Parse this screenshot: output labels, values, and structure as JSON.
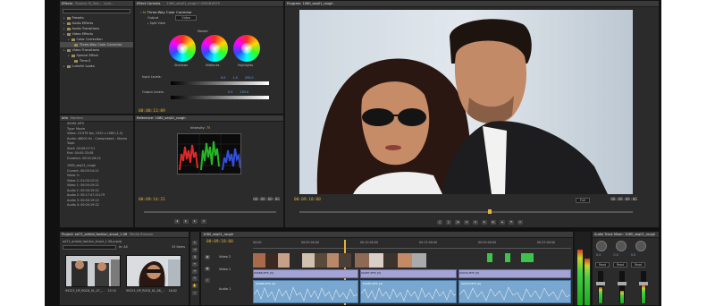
{
  "effects": {
    "tabs": [
      "Effects",
      "Source: FJ_Tod...",
      "Lum..."
    ],
    "search_placeholder": "",
    "tree": [
      {
        "label": "Presets",
        "level": 1
      },
      {
        "label": "Audio Effects",
        "level": 1
      },
      {
        "label": "Audio Transitions",
        "level": 1
      },
      {
        "label": "Video Effects",
        "level": 1
      },
      {
        "label": "Color Correction",
        "level": 2
      },
      {
        "label": "Three-Way Color Corrector",
        "level": 3,
        "selected": true
      },
      {
        "label": "Video Transitions",
        "level": 1
      },
      {
        "label": "Special Effect",
        "level": 2
      },
      {
        "label": "Time-S",
        "level": 3
      },
      {
        "label": "Lumetri Looks",
        "level": 1
      }
    ]
  },
  "effect_controls": {
    "tabs": [
      "Effect Controls",
      "",
      "1080_seq01_rough * 000081MTS"
    ],
    "effect_name": "Three-Way Color Corrector",
    "output_label": "Output",
    "output_value": "Video",
    "split_view_label": "Split View",
    "master_label": "Master",
    "wheels": [
      "Shadows",
      "Midtones",
      "Highlights"
    ],
    "input_levels_label": "Input Levels:",
    "input_values": [
      "0.0",
      "1.0",
      "255.0"
    ],
    "output_levels_label": "Output Levels:",
    "output_values": [
      "0.0",
      "255.0"
    ],
    "timecode": "00:00:13:09"
  },
  "info": {
    "tabs": [
      "Info",
      "Markers"
    ],
    "clip_name": "00081.MTS",
    "type": "Type: Movie",
    "video": "Video: 23.976 fps, 1920 x 1080 (1.0)",
    "audio": "Audio: 48000 Hz - Compressed - Stereo",
    "tape": "Tape:",
    "start": "Start: 00:00:07:11",
    "end": "End: 00:00:33:08",
    "duration": "Duration: 00:00:26:22",
    "seq_name": "1080_seq01_rough",
    "current": "Current: 00:09:14:21",
    "video3": "Video 3:",
    "video2": "Video 2: 01:00:12:21",
    "video1": "Video 1: 00:00:19:22",
    "audio1": "Audio 1: 00:00:19:22",
    "audio2": "Audio 2: 00:17:47:21179",
    "audio3": "Audio 3: 00:00:19:22",
    "audio4": "Audio 4: 00:00:19:22"
  },
  "reference": {
    "tabs": [
      "Reference: 1080_seq01_rough"
    ],
    "intensity_label": "Intensity:",
    "intensity_value": "75",
    "timecode_left": "00:09:14:21",
    "timecode_right": "00:08:00:06"
  },
  "program": {
    "tabs": [
      "Program: 1080_seq01_rough"
    ],
    "timecode_left": "00:09:18:00",
    "fit": "Full",
    "timecode_right": "00:08:00:06"
  },
  "project": {
    "tabs": [
      "Project: ad71_anfold_fashion_shoot_1.06",
      "Media Browser"
    ],
    "file": "ad71_anfold_fashion_shoot_1.06.prproj",
    "items_count": "25 Items",
    "in_label": "In:",
    "in_value": "All",
    "thumbs": [
      {
        "name": "99223_HP_R0C8_01_07_...",
        "dur": "25:15"
      },
      {
        "name": "99223_HP_R0C8_01_08_...",
        "dur": "16:02"
      }
    ]
  },
  "timeline": {
    "tabs": [
      "1080_seq01_rough"
    ],
    "timecode": "00:09:18:00",
    "ruler": [
      "00:00",
      "00:05:00:00",
      "00:10:00:00",
      "00:15:00:00",
      "00:20:00:00",
      "00:25:00:00"
    ],
    "tracks": {
      "video2": "Video 2",
      "video1": "Video 1",
      "audio1": "Audio 1"
    },
    "clip_labels": [
      "00086.MTS [V]",
      "00087.MTS [V]",
      "00074.MTS [V]"
    ],
    "audio_clip_labels": [
      "00086.MTS [A]",
      "00087.MTS [A]",
      "00074.MTS [A]"
    ]
  },
  "mixer": {
    "tabs": [
      "Audio Track Mixer: 1080_seq01_rough"
    ],
    "channels": [
      "Audio 1",
      "Audio 2",
      "Audio 3"
    ],
    "read_label": "Read",
    "values": [
      "0.0",
      "0.0",
      "0.0"
    ]
  }
}
